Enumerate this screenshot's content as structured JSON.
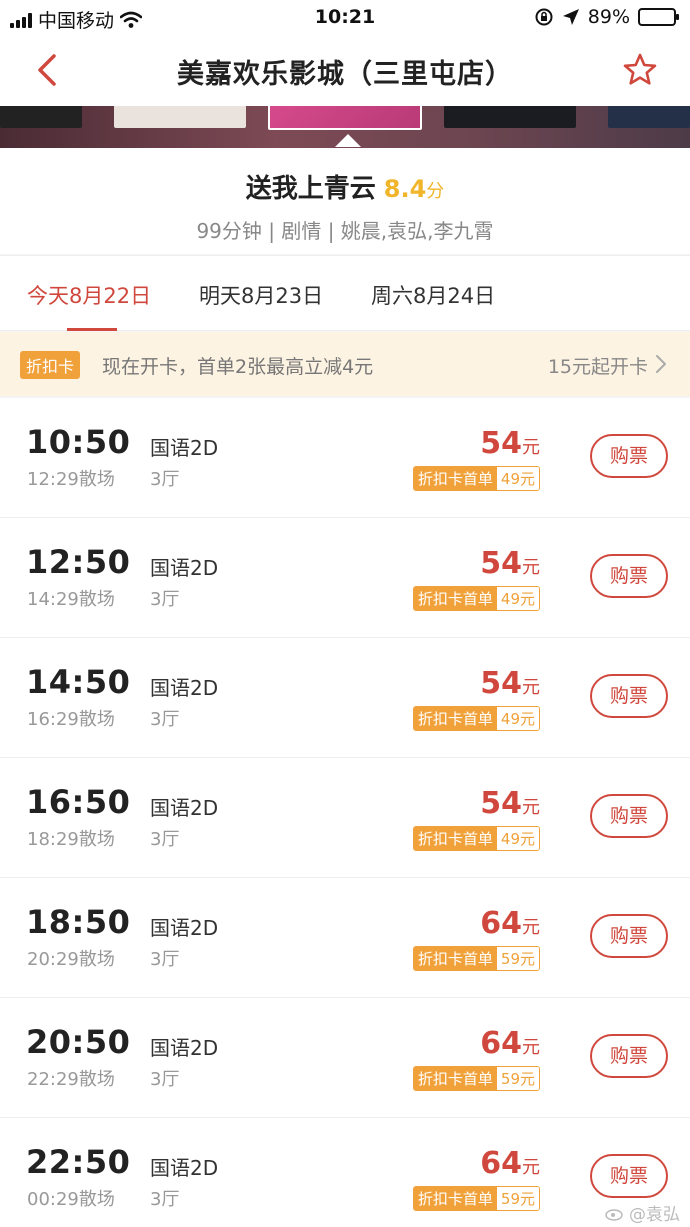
{
  "status_bar": {
    "carrier": "中国移动",
    "time": "10:21",
    "battery": "89%",
    "battery_level": 0.89
  },
  "nav": {
    "title": "美嘉欢乐影城（三里屯店）"
  },
  "movie": {
    "title": "送我上青云",
    "score": "8.4",
    "score_unit": "分",
    "meta": "99分钟 | 剧情 | 姚晨,袁弘,李九霄"
  },
  "date_tabs": [
    {
      "label": "今天8月22日"
    },
    {
      "label": "明天8月23日"
    },
    {
      "label": "周六8月24日"
    }
  ],
  "promo": {
    "badge": "折扣卡",
    "text": "现在开卡，首单2张最高立减4元",
    "cta": "15元起开卡"
  },
  "showtimes": [
    {
      "start": "10:50",
      "end": "12:29散场",
      "lang": "国语2D",
      "hall": "3厅",
      "price": "54",
      "unit": "元",
      "card_label": "折扣卡首单",
      "card_price": "49元",
      "buy": "购票"
    },
    {
      "start": "12:50",
      "end": "14:29散场",
      "lang": "国语2D",
      "hall": "3厅",
      "price": "54",
      "unit": "元",
      "card_label": "折扣卡首单",
      "card_price": "49元",
      "buy": "购票"
    },
    {
      "start": "14:50",
      "end": "16:29散场",
      "lang": "国语2D",
      "hall": "3厅",
      "price": "54",
      "unit": "元",
      "card_label": "折扣卡首单",
      "card_price": "49元",
      "buy": "购票"
    },
    {
      "start": "16:50",
      "end": "18:29散场",
      "lang": "国语2D",
      "hall": "3厅",
      "price": "54",
      "unit": "元",
      "card_label": "折扣卡首单",
      "card_price": "49元",
      "buy": "购票"
    },
    {
      "start": "18:50",
      "end": "20:29散场",
      "lang": "国语2D",
      "hall": "3厅",
      "price": "64",
      "unit": "元",
      "card_label": "折扣卡首单",
      "card_price": "59元",
      "buy": "购票"
    },
    {
      "start": "20:50",
      "end": "22:29散场",
      "lang": "国语2D",
      "hall": "3厅",
      "price": "64",
      "unit": "元",
      "card_label": "折扣卡首单",
      "card_price": "59元",
      "buy": "购票"
    },
    {
      "start": "22:50",
      "end": "00:29散场",
      "lang": "国语2D",
      "hall": "3厅",
      "price": "64",
      "unit": "元",
      "card_label": "折扣卡首单",
      "card_price": "59元",
      "buy": "购票"
    }
  ],
  "watermark": "@袁弘",
  "colors": {
    "accent": "#d0483d",
    "score": "#f1b52a",
    "card": "#f0a13a"
  }
}
